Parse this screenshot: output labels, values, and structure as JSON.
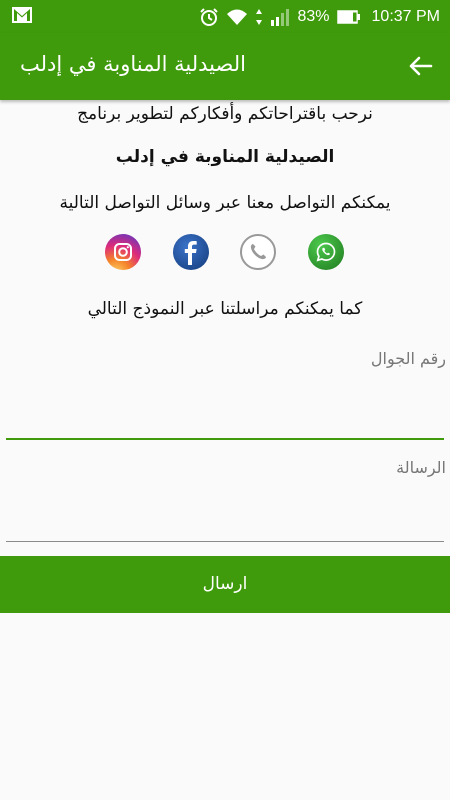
{
  "status_bar": {
    "battery": "83%",
    "time": "10:37 PM",
    "icons": [
      "gmail-icon",
      "alarm-icon",
      "wifi-icon",
      "signal-icon",
      "battery-icon"
    ]
  },
  "app_bar": {
    "title": "الصيدلية المناوبة في إدلب",
    "back_icon": "arrow-back-icon"
  },
  "intro": {
    "line1": "نرحب باقتراحاتكم وأفكاركم لتطوير برنامج",
    "line2": "الصيدلية المناوبة في إدلب",
    "line3": "يمكنكم التواصل معنا عبر وسائل التواصل التالية",
    "line4": "كما يمكنكم مراسلتنا عبر النموذج التالي"
  },
  "social": [
    {
      "name": "instagram",
      "icon": "instagram-icon"
    },
    {
      "name": "facebook",
      "icon": "facebook-icon"
    },
    {
      "name": "phone",
      "icon": "phone-icon"
    },
    {
      "name": "whatsapp",
      "icon": "whatsapp-icon"
    }
  ],
  "form": {
    "phone_label": "رقم الجوال",
    "phone_value": "",
    "message_label": "الرسالة",
    "message_value": "",
    "send_label": "ارسال"
  },
  "colors": {
    "primary": "#3f9b0b",
    "background": "#fafafa",
    "hint": "#777777",
    "instagram": "#c13584",
    "facebook": "#1b4f8f",
    "whatsapp": "#2e9a2e"
  }
}
